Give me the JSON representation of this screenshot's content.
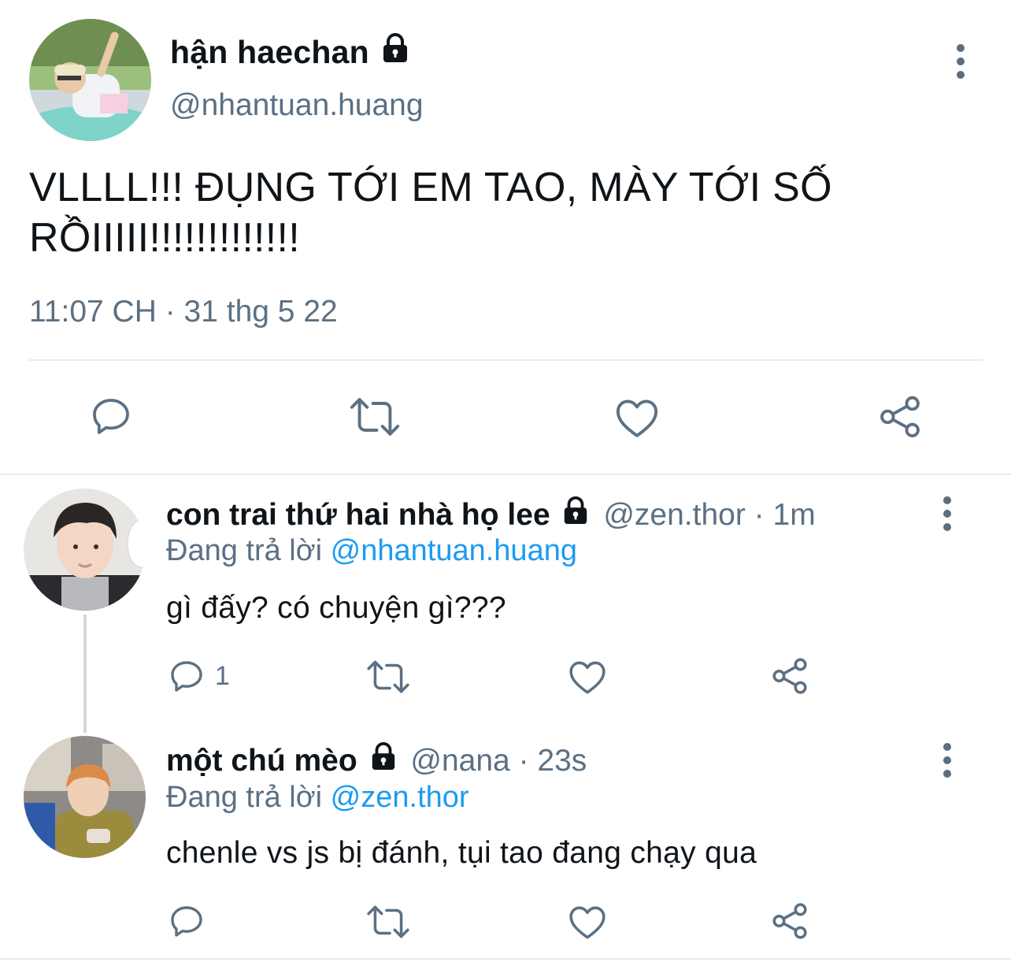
{
  "main_tweet": {
    "display_name": "hận haechan",
    "handle": "@nhantuan.huang",
    "text": "VLLLL!!! ĐỤNG TỚI EM TAO, MÀY TỚI SỐ RỒIIIII!!!!!!!!!!!!!",
    "timestamp": "11:07 CH · 31 thg 5 22",
    "actions": [
      "reply-icon",
      "retweet-icon",
      "like-icon",
      "share-icon"
    ]
  },
  "replies": [
    {
      "display_name": "con trai thứ hai nhà họ lee",
      "handle": "@zen.thor",
      "time": "1m",
      "replying_label": "Đang trả lời",
      "replying_to": "@nhantuan.huang",
      "text": "gì đấy? có chuyện gì???",
      "reply_count": "1"
    },
    {
      "display_name": "một chú mèo",
      "handle": "@nana",
      "time": "23s",
      "replying_label": "Đang trả lời",
      "replying_to": "@zen.thor",
      "text": "chenle vs js bị đánh, tụi tao đang chạy qua",
      "reply_count": ""
    }
  ],
  "colors": {
    "secondary_text": "#5b7083",
    "mention": "#1d9bf0",
    "divider": "#e6ecf0",
    "icon": "#5b7083"
  },
  "separator": " · "
}
